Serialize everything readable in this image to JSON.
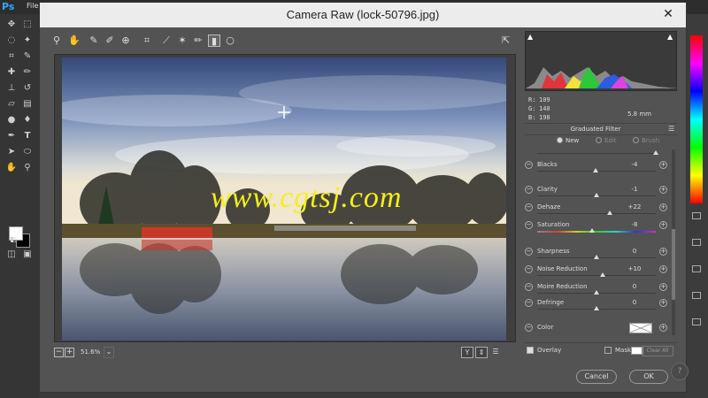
{
  "photoshop": {
    "logo": "Ps",
    "menu_file": "File"
  },
  "dialog": {
    "title": "Camera Raw (lock-50796.jpg)",
    "close_glyph": "✕"
  },
  "toolbar": {
    "icons": [
      "zoom-icon",
      "hand-icon",
      "white-balance-icon",
      "color-sampler-icon",
      "targeted-adjustment-icon",
      "crop-icon",
      "straighten-icon",
      "spot-removal-icon",
      "red-eye-icon",
      "adjustment-brush-icon",
      "graduated-filter-icon",
      "radial-filter-icon"
    ]
  },
  "preview": {
    "watermark": "www.cgtsj.com",
    "colors": {
      "watermark": "#f5ef1a",
      "sky_top": "#3a4f7a",
      "sky_mid": "#a9bbd2",
      "water": "#8f9aa8"
    }
  },
  "status": {
    "zoom": "51.6%",
    "zoom_out": "−",
    "zoom_in": "+",
    "view_y": "Y",
    "view_compare": "⇕"
  },
  "readout": {
    "r_label": "R:",
    "r_value": "109",
    "g_label": "G:",
    "g_value": "140",
    "b_label": "B:",
    "b_value": "198",
    "distance": "5.8 mm"
  },
  "panel": {
    "title": "Graduated Filter",
    "modes": [
      {
        "label": "New",
        "selected": true
      },
      {
        "label": "Edit",
        "selected": false
      },
      {
        "label": "Brush",
        "selected": false
      }
    ],
    "sliders": [
      {
        "label": "Blacks",
        "value": "-4",
        "position": 0.49
      },
      {
        "label": "Clarity",
        "value": "-1",
        "position": 0.5
      },
      {
        "label": "Dehaze",
        "value": "+22",
        "position": 0.61
      },
      {
        "label": "Saturation",
        "value": "-8",
        "position": 0.46
      },
      {
        "label": "Sharpness",
        "value": "0",
        "position": 0.5
      },
      {
        "label": "Noise Reduction",
        "value": "+10",
        "position": 0.55
      },
      {
        "label": "Moire Reduction",
        "value": "0",
        "position": 0.5
      },
      {
        "label": "Defringe",
        "value": "0",
        "position": 0.5
      }
    ],
    "color_label": "Color",
    "overlay_label": "Overlay",
    "overlay_checked": true,
    "mask_label": "Mask",
    "mask_checked": false,
    "clear_all": "Clear All"
  },
  "footer": {
    "cancel": "Cancel",
    "ok": "OK",
    "help": "?"
  }
}
